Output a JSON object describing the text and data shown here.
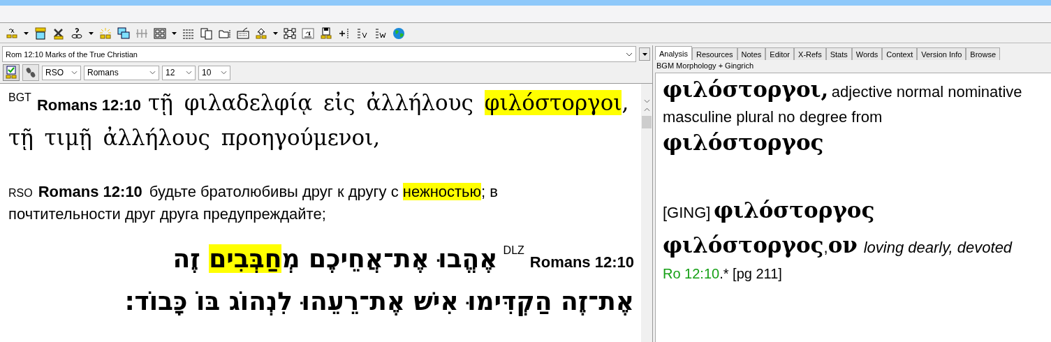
{
  "reference_box": {
    "value": "Rom 12:10 Marks of the True Christian"
  },
  "selectors": [
    {
      "value": "RSO",
      "kind": "version"
    },
    {
      "value": "Romans",
      "kind": "book"
    },
    {
      "value": "12",
      "kind": "chapter"
    },
    {
      "value": "10",
      "kind": "verse"
    }
  ],
  "verses": [
    {
      "version": "BGT",
      "reference": "Romans 12:10",
      "kind": "greek",
      "segments": [
        {
          "text": "τῇ φιλαδελφίᾳ εἰς ἀλλήλους ",
          "highlighted": false
        },
        {
          "text": "φιλόστοργοι",
          "highlighted": true
        },
        {
          "text": ", τῇ τιμῇ ἀλλήλους προηγούμενοι,",
          "highlighted": false
        }
      ]
    },
    {
      "version": "RSO",
      "reference": "Romans 12:10",
      "kind": "latin",
      "segments": [
        {
          "text": "будьте братолюбивы друг к другу с ",
          "highlighted": false
        },
        {
          "text": "нежностью",
          "highlighted": true
        },
        {
          "text": "; в почтительности друг друга предупреждайте;",
          "highlighted": false
        }
      ]
    },
    {
      "version": "DLZ",
      "reference": "Romans 12:10",
      "kind": "hebrew",
      "segments": [
        {
          "text": "אֶהֱבוּ אֶת־אֲחֵיכֶם מְ",
          "highlighted": false
        },
        {
          "text": "חַבְּבִים",
          "highlighted": true
        },
        {
          "text": " זֶה אֶת־זֶה הַקְדִּימוּ אִישׁ אֶת־רֵעֵהוּ לִנְהוֹג בּוֹ כָּבוֹד׃",
          "highlighted": false
        }
      ]
    }
  ],
  "tabs": [
    {
      "label": "Analysis",
      "selected": true
    },
    {
      "label": "Resources",
      "selected": false
    },
    {
      "label": "Notes",
      "selected": false
    },
    {
      "label": "Editor",
      "selected": false
    },
    {
      "label": "X-Refs",
      "selected": false
    },
    {
      "label": "Stats",
      "selected": false
    },
    {
      "label": "Words",
      "selected": false
    },
    {
      "label": "Context",
      "selected": false
    },
    {
      "label": "Version Info",
      "selected": false
    },
    {
      "label": "Browse",
      "selected": false
    }
  ],
  "analysis_source": "BGM Morphology + Gingrich",
  "analysis": {
    "word": "φιλόστοργοι,",
    "parsing": "adjective normal nominative masculine plural no degree from",
    "lemma": "φιλόστοργος"
  },
  "lexicon": {
    "source": "[GING]",
    "headword": "φιλόστοργος",
    "entry_word": "φιλόστοργος",
    "entry_separator": ",",
    "entry_ending": "ον",
    "gloss": "loving dearly, devoted",
    "reference_link": "Ro 12:10",
    "reference_note": ".* [pg 211]"
  }
}
